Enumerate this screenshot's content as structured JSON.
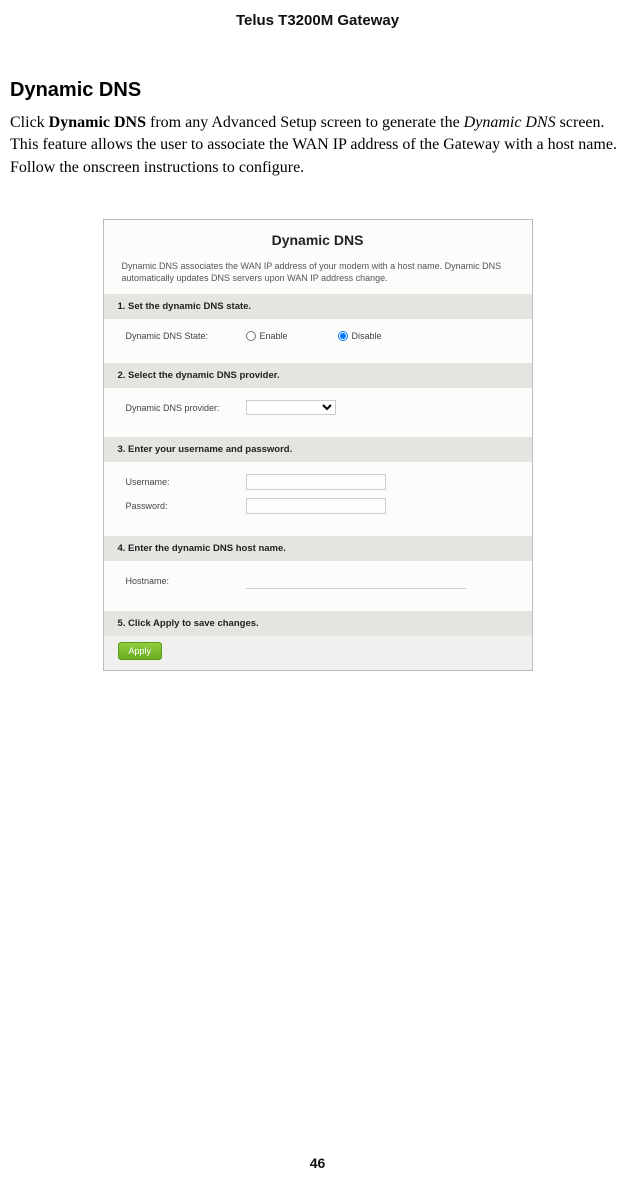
{
  "doc_header": "Telus T3200M Gateway",
  "section_title": "Dynamic DNS",
  "paragraph": {
    "pre": "Click ",
    "link_bold": "Dynamic DNS",
    "mid1": " from any Advanced Setup screen to generate the ",
    "italic": "Dynamic DNS",
    "mid2": " screen. This feature allows the user to associate the WAN IP address of the Gateway with a host name. Follow the onscreen instructions to configure."
  },
  "router": {
    "title": "Dynamic DNS",
    "desc": "Dynamic DNS associates the WAN IP address of your modem with a host name. Dynamic DNS automatically updates DNS servers upon WAN IP address change.",
    "step1_header": "1. Set the dynamic DNS state.",
    "state_label": "Dynamic DNS State:",
    "enable_label": "Enable",
    "disable_label": "Disable",
    "step2_header": "2. Select the dynamic DNS provider.",
    "provider_label": "Dynamic DNS provider:",
    "step3_header": "3. Enter your username and password.",
    "username_label": "Username:",
    "password_label": "Password:",
    "step4_header": "4. Enter the dynamic DNS host name.",
    "hostname_label": "Hostname:",
    "step5_header": "5. Click Apply to save changes.",
    "apply_label": "Apply"
  },
  "page_number": "46"
}
